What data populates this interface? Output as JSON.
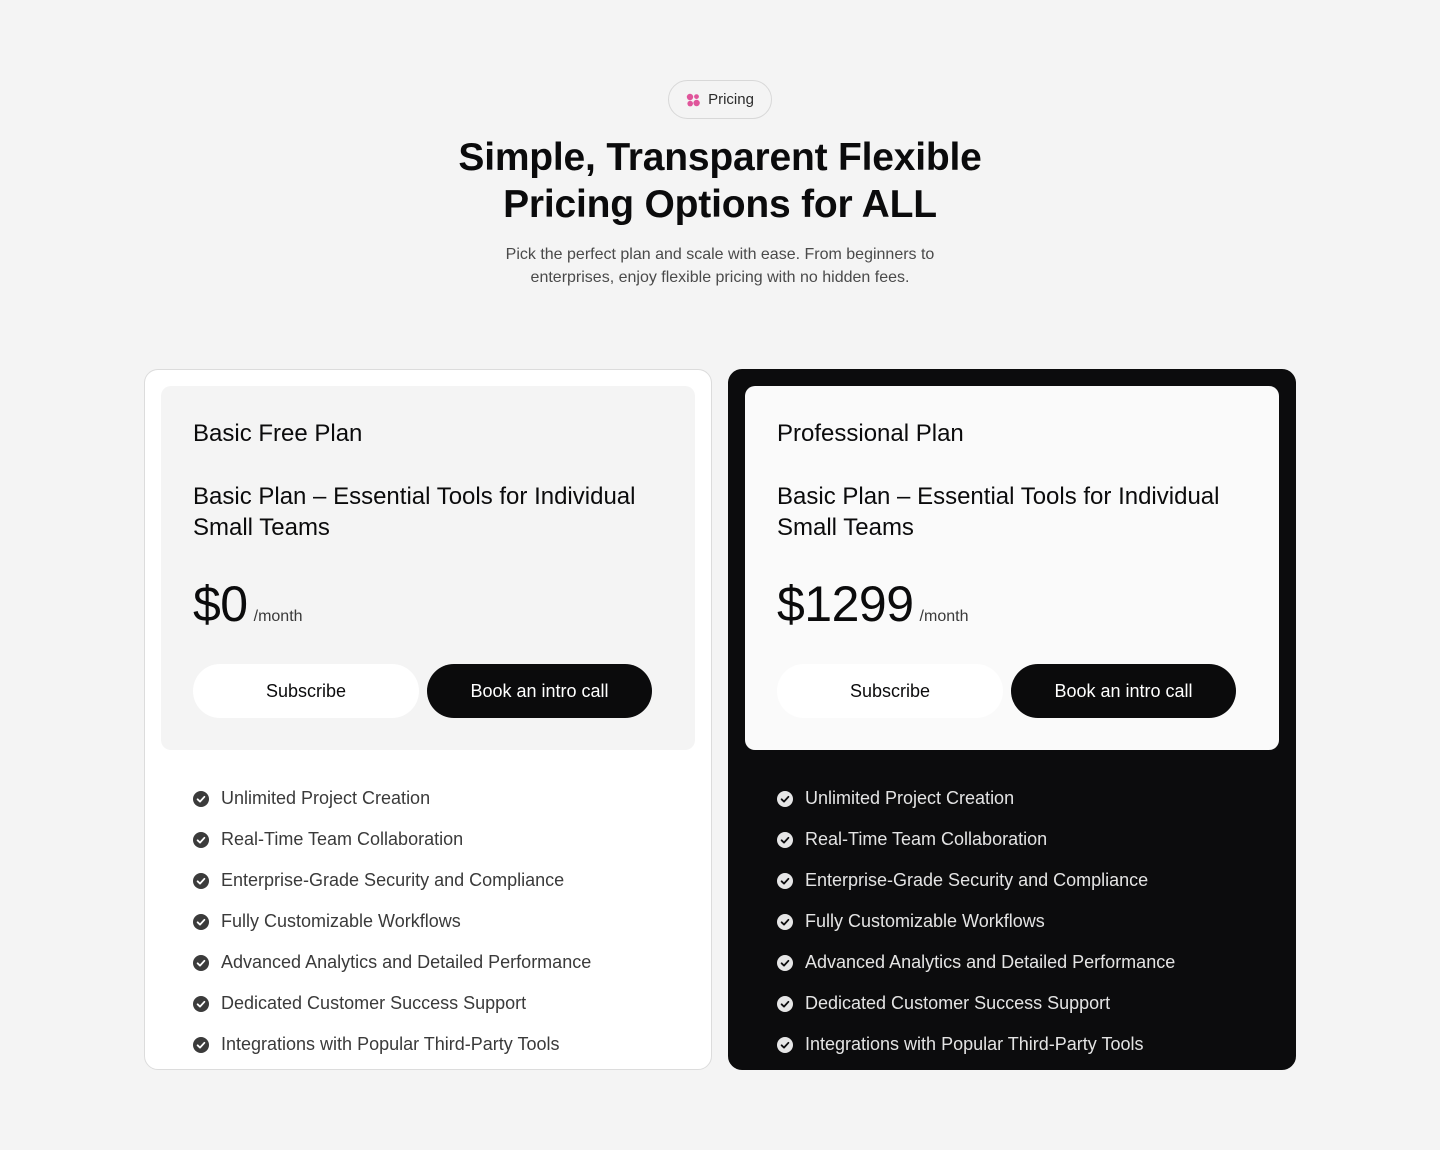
{
  "colors": {
    "page_bg": "#f4f4f4",
    "accent_pink": "#e0559b",
    "dark_card": "#0c0c0d",
    "primary_button": "#0b0b0c"
  },
  "header": {
    "badge_icon": "pink-dots-icon",
    "badge_label": "Pricing",
    "title_line1": "Simple, Transparent Flexible",
    "title_line2": "Pricing Options for ALL",
    "subtitle_line1": "Pick the perfect plan and scale with ease. From beginners to",
    "subtitle_line2": "enterprises, enjoy flexible pricing with no hidden fees."
  },
  "plans": [
    {
      "name": "Basic Free Plan",
      "description": "Basic Plan – Essential Tools for Individual Small Teams",
      "price": "$0",
      "period": "/month",
      "subscribe_label": "Subscribe",
      "intro_call_label": "Book an intro call",
      "check_icon": "check-circle-icon",
      "features": [
        "Unlimited Project Creation",
        "Real-Time Team Collaboration",
        "Enterprise-Grade Security and Compliance",
        "Fully Customizable Workflows",
        "Advanced Analytics and Detailed Performance",
        "Dedicated Customer Success Support",
        "Integrations with Popular Third-Party Tools"
      ]
    },
    {
      "name": "Professional Plan",
      "description": "Basic Plan – Essential Tools for Individual Small Teams",
      "price": "$1299",
      "period": "/month",
      "subscribe_label": "Subscribe",
      "intro_call_label": "Book an intro call",
      "check_icon": "check-circle-icon",
      "features": [
        "Unlimited Project Creation",
        "Real-Time Team Collaboration",
        "Enterprise-Grade Security and Compliance",
        "Fully Customizable Workflows",
        "Advanced Analytics and Detailed Performance",
        "Dedicated Customer Success Support",
        "Integrations with Popular Third-Party Tools"
      ]
    }
  ]
}
